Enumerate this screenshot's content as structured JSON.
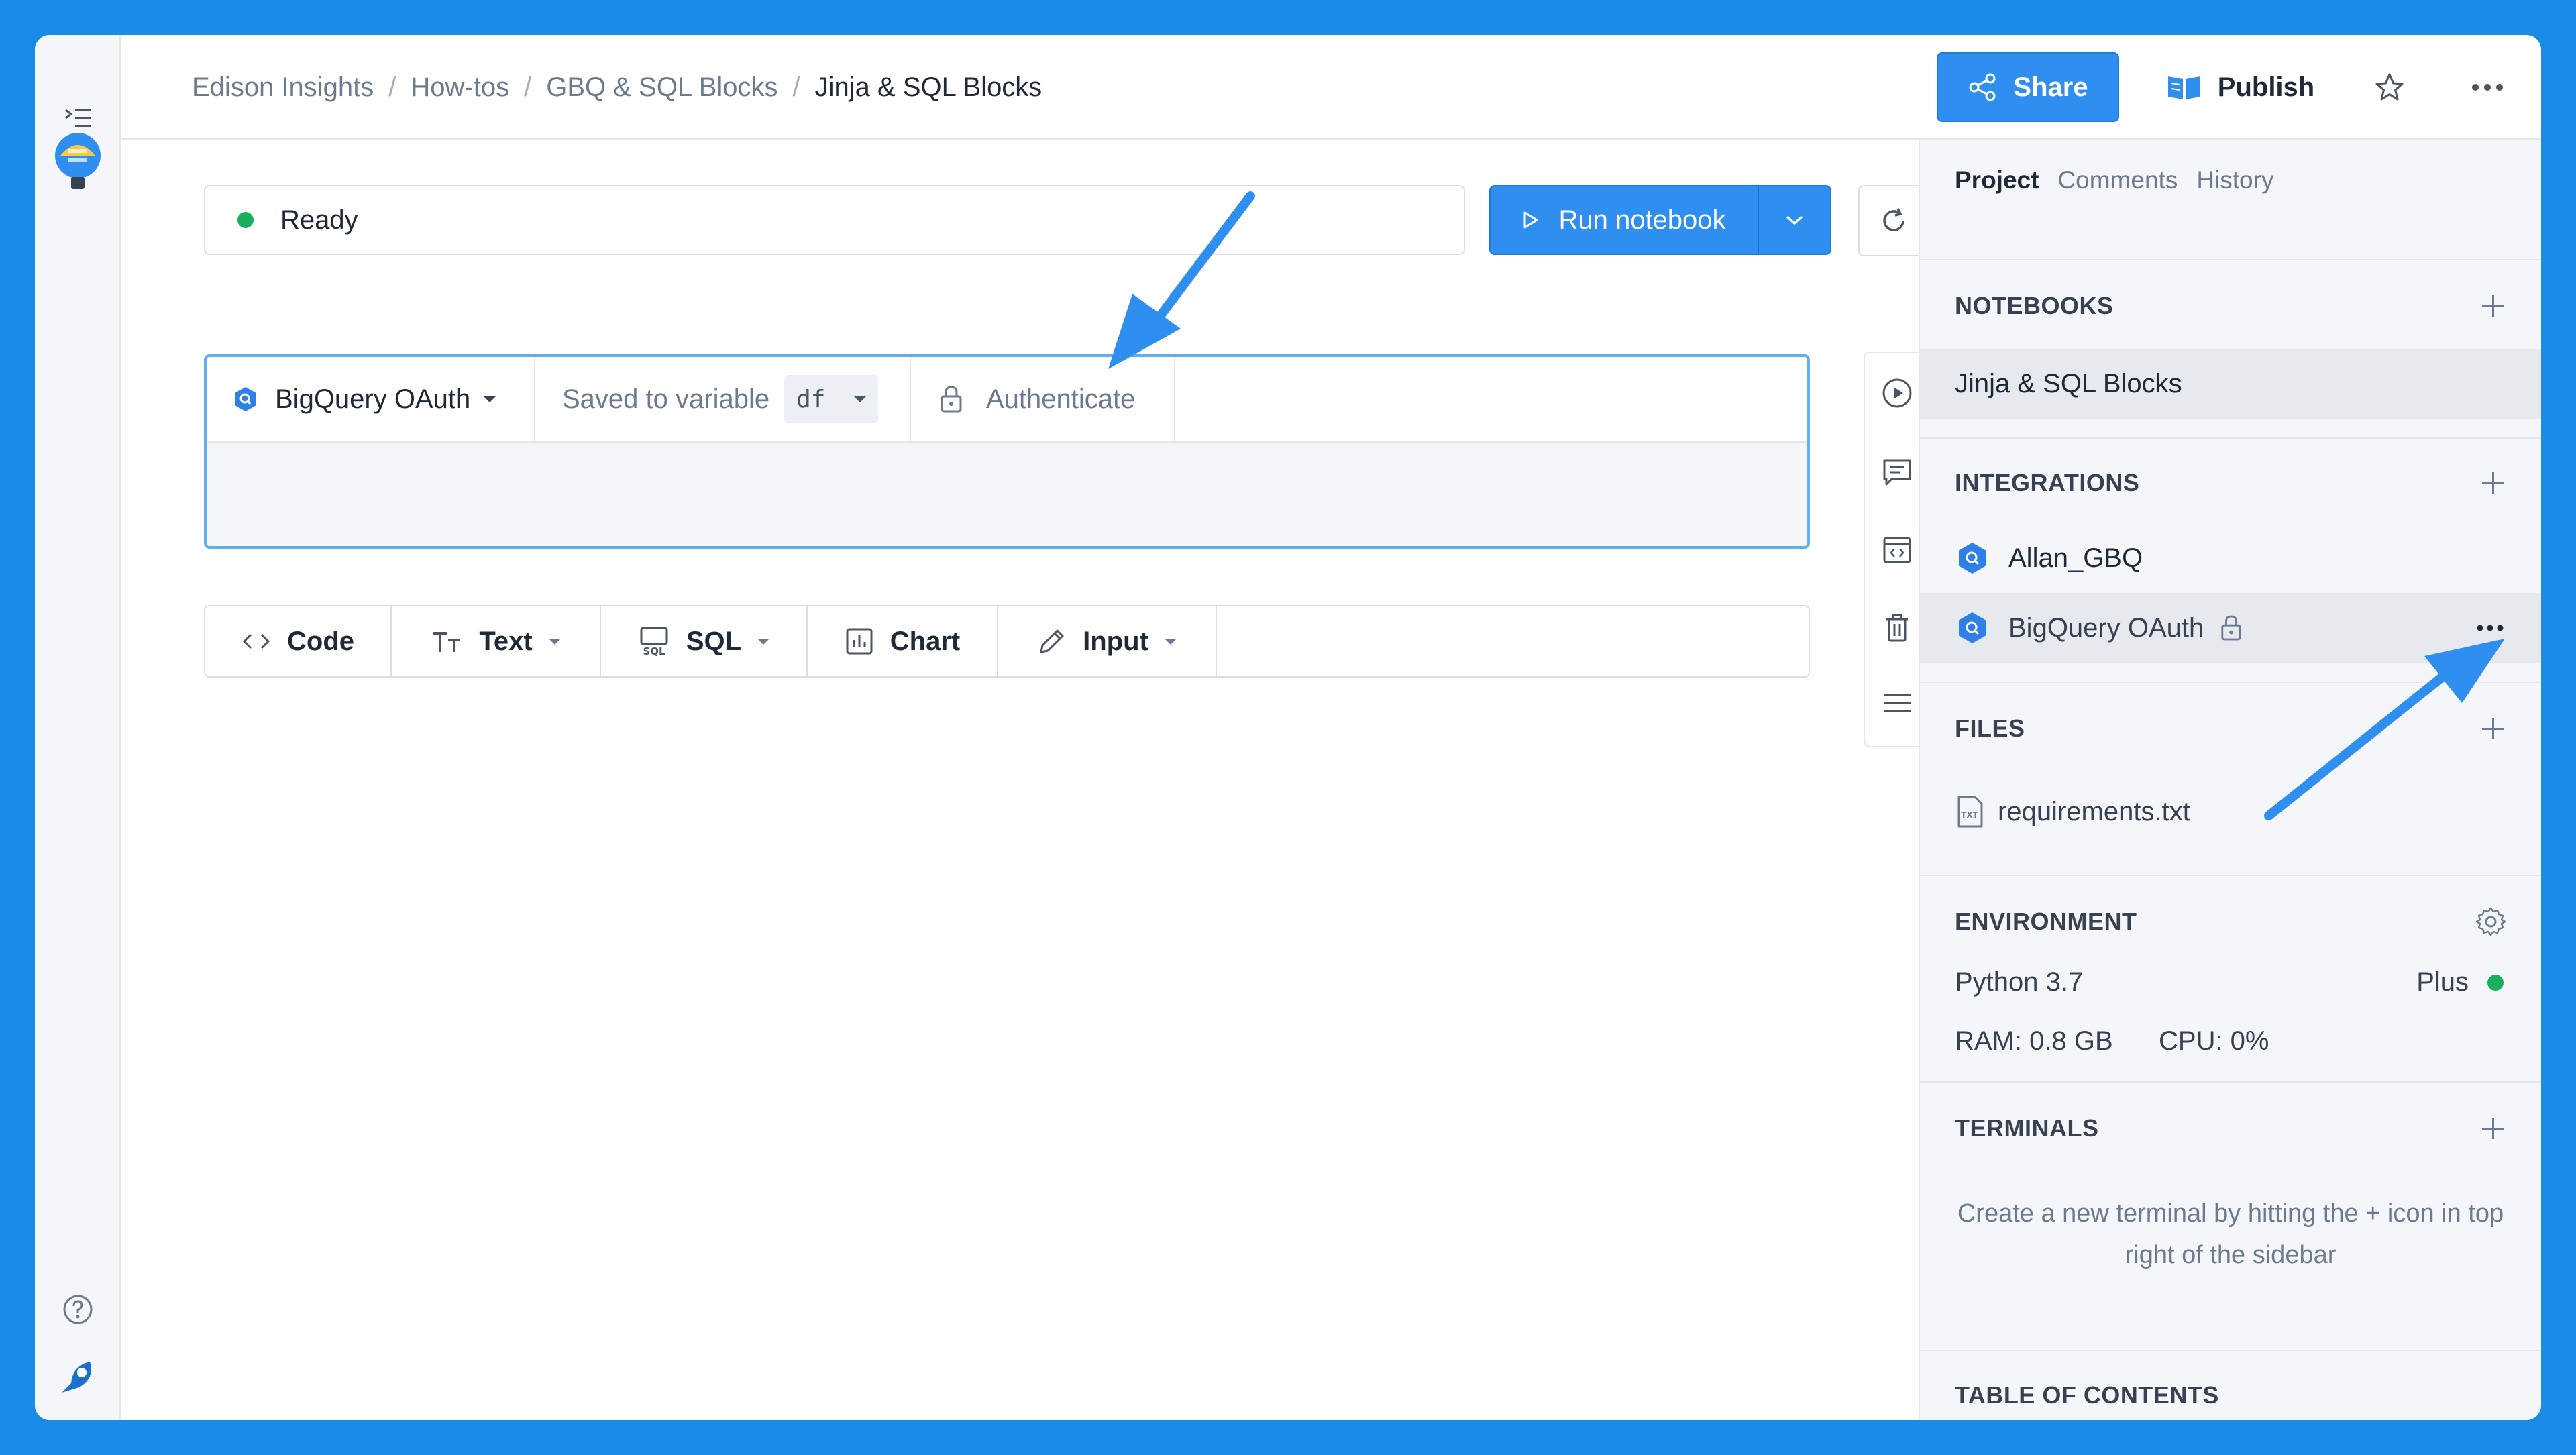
{
  "breadcrumb": [
    "Edison Insights",
    "How-tos",
    "GBQ & SQL Blocks",
    "Jinja & SQL Blocks"
  ],
  "header": {
    "share_label": "Share",
    "publish_label": "Publish"
  },
  "status": {
    "text": "Ready",
    "color": "#1aaf5d"
  },
  "run_button": {
    "label": "Run notebook"
  },
  "sql_block": {
    "connection": "BigQuery OAuth",
    "saved_label": "Saved to variable",
    "variable": "df",
    "auth_label": "Authenticate"
  },
  "add_bar": [
    {
      "label": "Code",
      "icon": "code-icon"
    },
    {
      "label": "Text",
      "icon": "text-icon"
    },
    {
      "label": "SQL",
      "icon": "sql-icon"
    },
    {
      "label": "Chart",
      "icon": "chart-icon"
    },
    {
      "label": "Input",
      "icon": "pencil-icon"
    }
  ],
  "sidebar": {
    "tabs": [
      "Project",
      "Comments",
      "History"
    ],
    "notebooks": {
      "title": "NOTEBOOKS",
      "items": [
        "Jinja & SQL Blocks"
      ]
    },
    "integrations": {
      "title": "INTEGRATIONS",
      "items": [
        "Allan_GBQ",
        "BigQuery OAuth"
      ]
    },
    "files": {
      "title": "FILES",
      "items": [
        "requirements.txt"
      ]
    },
    "environment": {
      "title": "ENVIRONMENT",
      "python": "Python 3.7",
      "plan": "Plus",
      "ram": "RAM: 0.8 GB",
      "cpu": "CPU: 0%"
    },
    "terminals": {
      "title": "TERMINALS",
      "help": "Create a new terminal by hitting the + icon in top right of the sidebar"
    },
    "toc": {
      "title": "TABLE OF CONTENTS"
    }
  },
  "colors": {
    "accent": "#2f8ff0",
    "background": "#1a8be6",
    "annotation_arrow": "#2f8ff0"
  }
}
